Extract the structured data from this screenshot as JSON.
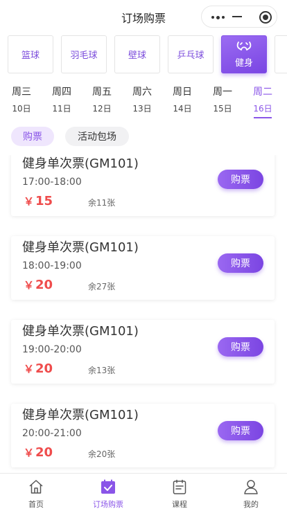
{
  "header": {
    "title": "订场购票"
  },
  "sports": [
    {
      "label": "篮球",
      "active": false
    },
    {
      "label": "羽毛球",
      "active": false
    },
    {
      "label": "壁球",
      "active": false
    },
    {
      "label": "乒乓球",
      "active": false
    },
    {
      "label": "健身",
      "active": true,
      "icon": "dumbbell-icon"
    }
  ],
  "days": [
    {
      "week": "周三",
      "date": "10日"
    },
    {
      "week": "周四",
      "date": "11日"
    },
    {
      "week": "周五",
      "date": "12日"
    },
    {
      "week": "周六",
      "date": "13日"
    },
    {
      "week": "周日",
      "date": "14日"
    },
    {
      "week": "周一",
      "date": "15日"
    },
    {
      "week": "周二",
      "date": "16日",
      "active": true
    }
  ],
  "modes": {
    "buy": "购票",
    "package": "活动包场"
  },
  "tickets": [
    {
      "name": "健身单次票(GM101)",
      "time": "17:00-18:00",
      "currency": "￥",
      "price": "15",
      "left": "余11张",
      "button": "购票"
    },
    {
      "name": "健身单次票(GM101)",
      "time": "18:00-19:00",
      "currency": "￥",
      "price": "20",
      "left": "余27张",
      "button": "购票"
    },
    {
      "name": "健身单次票(GM101)",
      "time": "19:00-20:00",
      "currency": "￥",
      "price": "20",
      "left": "余13张",
      "button": "购票"
    },
    {
      "name": "健身单次票(GM101)",
      "time": "20:00-21:00",
      "currency": "￥",
      "price": "20",
      "left": "余20张",
      "button": "购票"
    }
  ],
  "tabbar": [
    {
      "label": "首页",
      "icon": "home-icon"
    },
    {
      "label": "订场购票",
      "icon": "calendar-check-icon",
      "active": true
    },
    {
      "label": "课程",
      "icon": "course-list-icon"
    },
    {
      "label": "我的",
      "icon": "user-icon"
    }
  ],
  "colors": {
    "accent": "#8a55e8",
    "price": "#ef4c4c"
  }
}
